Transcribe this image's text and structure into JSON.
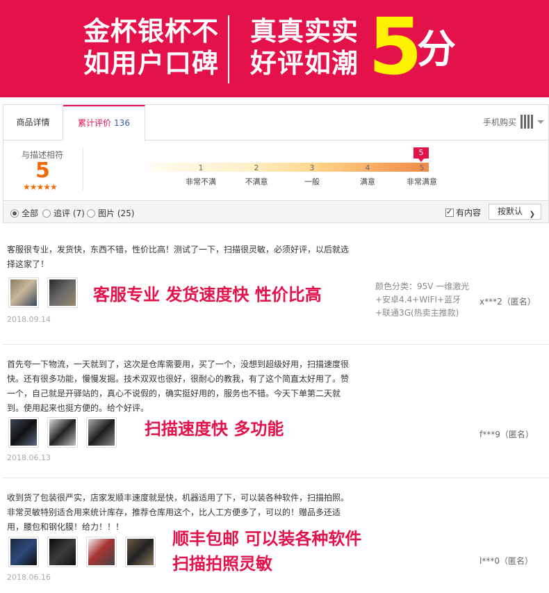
{
  "banner": {
    "line1_left": "金杯银杯不",
    "line2_left": "如用户口碑",
    "line1_right": "真真实实",
    "line2_right": "好评如潮",
    "score": "5",
    "unit": "分"
  },
  "tabs": {
    "detail": "商品详情",
    "reviews": "累计评价",
    "reviews_count": "136",
    "mobile_buy": "手机购买"
  },
  "rating": {
    "match_label": "与描述相符",
    "match_score": "5",
    "stars": "★★★★★",
    "current_score": "5",
    "ticks": [
      "1",
      "2",
      "3",
      "4",
      "5"
    ],
    "labels": [
      "非常不满",
      "不满意",
      "一般",
      "满意",
      "非常满意"
    ]
  },
  "filter": {
    "all": "全部",
    "followup": "追评 (7)",
    "images": "图片 (25)",
    "has_content": "有内容",
    "sort": "按默认"
  },
  "reviews": [
    {
      "text": "客服很专业，发货快，东西不错，性价比高！测试了一下，扫描很灵敏，必须好评，以后就选择这家了！",
      "highlight": [
        "客服专业 发货速度快 性价比高"
      ],
      "date": "2018.09.14",
      "sku": [
        "颜色分类：95V 一维激光",
        "+安卓4.4+WIFI+蓝牙",
        "+联通3G(热卖主推款)"
      ],
      "user": "x***2（匿名）"
    },
    {
      "text": "首先夸一下物流，一天就到了，这次是仓库需要用，买了一个，没想到超级好用，扫描速度很快。还有很多功能，慢慢发掘。技术双双也很好，很耐心的教我，有了这个简直太好用了。赞一个，自己就是开驿站的，真心不说假的，确实挺好用的，服务也不错。今天下单第二天就到。使用起来也挺方便的。给个好评。",
      "highlight": [
        "扫描速度快 多功能"
      ],
      "date": "2018.06.13",
      "user": "f***9（匿名）"
    },
    {
      "text": "收到货了包装很严实，店家发顺丰速度就是快，机器适用了下，可以装各种软件，扫描拍照。非常灵敏特别适合用来统计库存，推荐仓库用这个，比人工方便多了，可以的！赠品多还适用，腰包和钢化膜！给力！！！",
      "highlight": [
        "顺丰包邮 可以装各种软件",
        "扫描拍照灵敏"
      ],
      "date": "2018.06.16",
      "user": "l***0（匿名）"
    }
  ],
  "colors": {
    "brand": "#e4114a",
    "score_yellow": "#fff200",
    "rating_orange": "#f26a05",
    "link_blue": "#3a5fad"
  }
}
